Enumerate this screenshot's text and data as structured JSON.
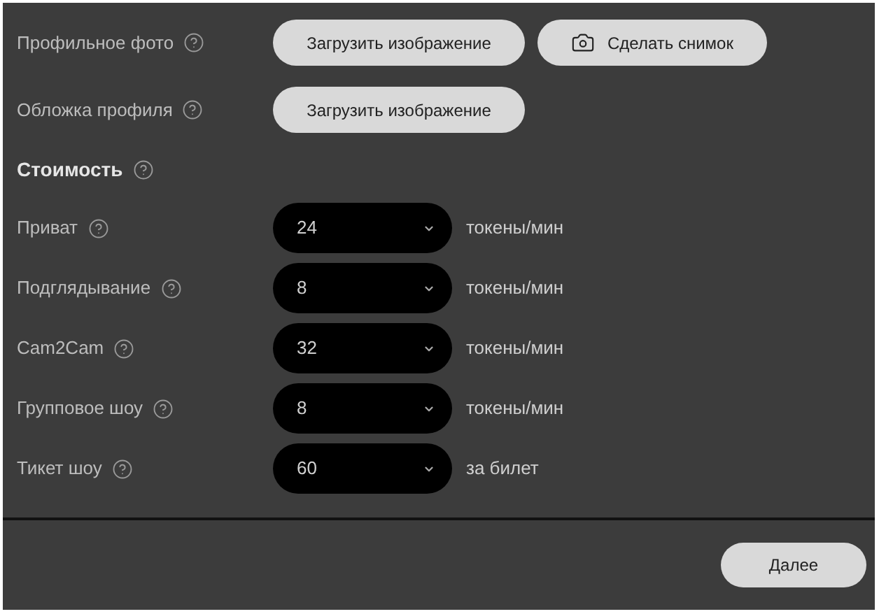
{
  "media_rows": [
    {
      "label": "Профильное фото",
      "buttons": [
        {
          "label": "Загрузить изображение",
          "kind": "upload"
        },
        {
          "label": "Сделать снимок",
          "kind": "camera"
        }
      ]
    },
    {
      "label": "Обложка профиля",
      "buttons": [
        {
          "label": "Загрузить изображение",
          "kind": "upload"
        }
      ]
    }
  ],
  "pricing": {
    "title": "Стоимость",
    "rows": [
      {
        "label": "Приват",
        "value": "24",
        "unit": "токены/мин"
      },
      {
        "label": "Подглядывание",
        "value": "8",
        "unit": "токены/мин"
      },
      {
        "label": "Cam2Cam",
        "value": "32",
        "unit": "токены/мин"
      },
      {
        "label": "Групповое шоу",
        "value": "8",
        "unit": "токены/мин"
      },
      {
        "label": "Тикет шоу",
        "value": "60",
        "unit": "за билет"
      }
    ]
  },
  "footer": {
    "next_button": "Далее"
  }
}
